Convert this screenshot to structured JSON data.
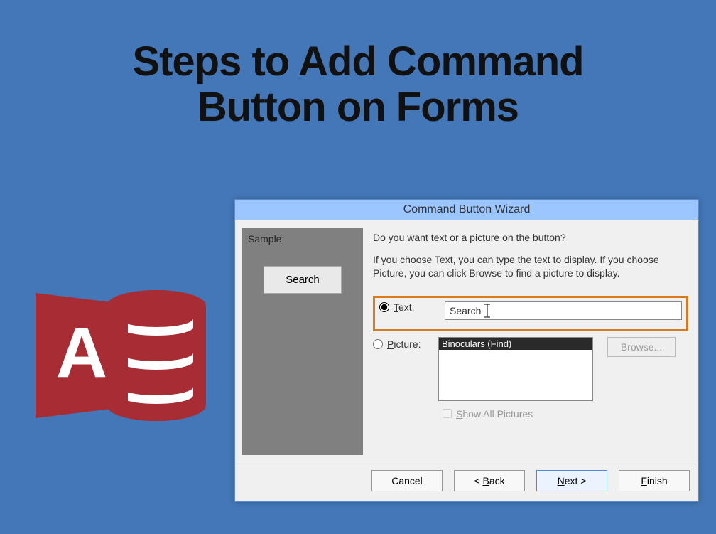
{
  "slide": {
    "title_line1": "Steps to Add Command",
    "title_line2": "Button on Forms"
  },
  "logo": {
    "letter": "A",
    "name": "Microsoft Access"
  },
  "wizard": {
    "title": "Command Button Wizard",
    "sample_label": "Sample:",
    "sample_button_text": "Search",
    "prompt1": "Do you want text or a picture on the button?",
    "prompt2": "If you choose Text, you can type the text to display.  If you choose Picture, you can click Browse to find a picture to display.",
    "options": {
      "text": {
        "label_prefix": "",
        "label_ul": "T",
        "label_rest": "ext:",
        "selected": true,
        "value": "Search"
      },
      "picture": {
        "label_ul": "P",
        "label_rest": "icture:",
        "selected": false,
        "list_selected": "Binoculars (Find)"
      }
    },
    "browse_label": "Browse...",
    "show_all_ul": "S",
    "show_all_rest": "how All Pictures",
    "buttons": {
      "cancel": "Cancel",
      "back_prefix": "< ",
      "back_ul": "B",
      "back_rest": "ack",
      "next_ul": "N",
      "next_rest": "ext >",
      "finish_ul": "F",
      "finish_rest": "inish"
    }
  }
}
